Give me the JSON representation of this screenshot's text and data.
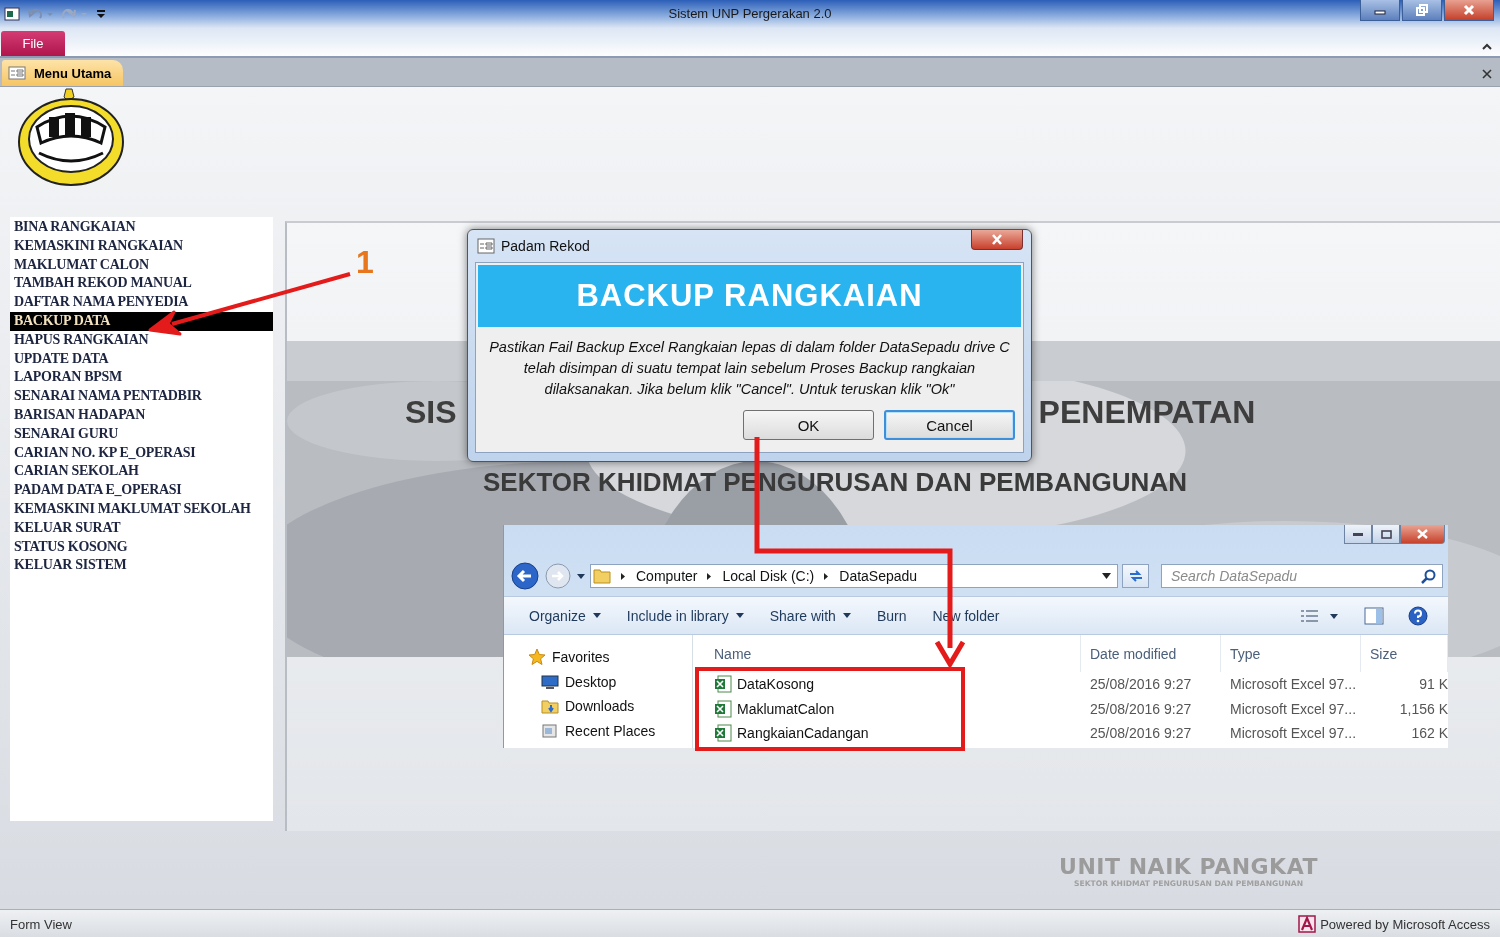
{
  "window": {
    "title": "Sistem UNP Pergerakan 2.0"
  },
  "ribbon": {
    "file_tab": "File"
  },
  "document_tab": {
    "label": "Menu Utama"
  },
  "menu": {
    "items": [
      {
        "label": "BINA RANGKAIAN",
        "selected": false
      },
      {
        "label": "KEMASKINI RANGKAIAN",
        "selected": false
      },
      {
        "label": "MAKLUMAT CALON",
        "selected": false
      },
      {
        "label": "TAMBAH REKOD MANUAL",
        "selected": false
      },
      {
        "label": "DAFTAR NAMA PENYEDIA",
        "selected": false
      },
      {
        "label": "BACKUP DATA",
        "selected": true
      },
      {
        "label": "HAPUS RANGKAIAN",
        "selected": false
      },
      {
        "label": "UPDATE DATA",
        "selected": false
      },
      {
        "label": "LAPORAN BPSM",
        "selected": false
      },
      {
        "label": "SENARAI NAMA PENTADBIR",
        "selected": false
      },
      {
        "label": "BARISAN HADAPAN",
        "selected": false
      },
      {
        "label": "SENARAI GURU",
        "selected": false
      },
      {
        "label": "CARIAN NO. KP E_OPERASI",
        "selected": false
      },
      {
        "label": "CARIAN SEKOLAH",
        "selected": false
      },
      {
        "label": "PADAM DATA E_OPERASI",
        "selected": false
      },
      {
        "label": "KEMASKINI MAKLUMAT SEKOLAH",
        "selected": false
      },
      {
        "label": "KELUAR SURAT",
        "selected": false
      },
      {
        "label": "STATUS KOSONG",
        "selected": false
      },
      {
        "label": "KELUAR SISTEM",
        "selected": false
      }
    ]
  },
  "banner": {
    "heading_left": "SIS",
    "heading_right": "PENEMPATAN",
    "subheading": "SEKTOR KHIDMAT PENGURUSAN DAN PEMBANGUNAN"
  },
  "unit_logo": {
    "text": "UNIT NAIK PANGKAT",
    "subtext": "SEKTOR KHIDMAT PENGURUSAN DAN PEMBANGUNAN"
  },
  "dialog": {
    "title": "Padam Rekod",
    "header": "BACKUP RANGKAIAN",
    "message": "Pastikan Fail Backup Excel Rangkaian lepas di dalam folder DataSepadu drive C telah disimpan di suatu tempat lain sebelum Proses Backup rangkaian dilaksanakan. Jika belum klik \"Cancel\". Untuk teruskan klik \"Ok\"",
    "buttons": [
      {
        "label": "OK",
        "selected": false
      },
      {
        "label": "Cancel",
        "selected": true
      }
    ]
  },
  "explorer": {
    "breadcrumb": [
      "Computer",
      "Local Disk (C:)",
      "DataSepadu"
    ],
    "search": {
      "placeholder": "Search DataSepadu"
    },
    "toolbar": [
      {
        "label": "Organize",
        "kind": "menu"
      },
      {
        "label": "Include in library",
        "kind": "menu"
      },
      {
        "label": "Share with",
        "kind": "menu"
      },
      {
        "label": "Burn",
        "kind": "action"
      },
      {
        "label": "New folder",
        "kind": "action"
      }
    ],
    "nav": [
      {
        "label": "Favorites",
        "kind": "favorites"
      },
      {
        "label": "Desktop",
        "kind": "desktop"
      },
      {
        "label": "Downloads",
        "kind": "downloads"
      },
      {
        "label": "Recent Places",
        "kind": "recent"
      }
    ],
    "columns": [
      "Name",
      "Date modified",
      "Type",
      "Size"
    ],
    "files": [
      {
        "name": "DataKosong",
        "date": "25/08/2016 9:27",
        "type": "Microsoft Excel 97...",
        "size": "91 K"
      },
      {
        "name": "MaklumatCalon",
        "date": "25/08/2016 9:27",
        "type": "Microsoft Excel 97...",
        "size": "1,156 K"
      },
      {
        "name": "RangkaianCadangan",
        "date": "25/08/2016 9:27",
        "type": "Microsoft Excel 97...",
        "size": "162 K"
      }
    ]
  },
  "annotation": {
    "step": "1"
  },
  "status_bar": {
    "left": "Form View",
    "right": "Powered by Microsoft Access"
  }
}
